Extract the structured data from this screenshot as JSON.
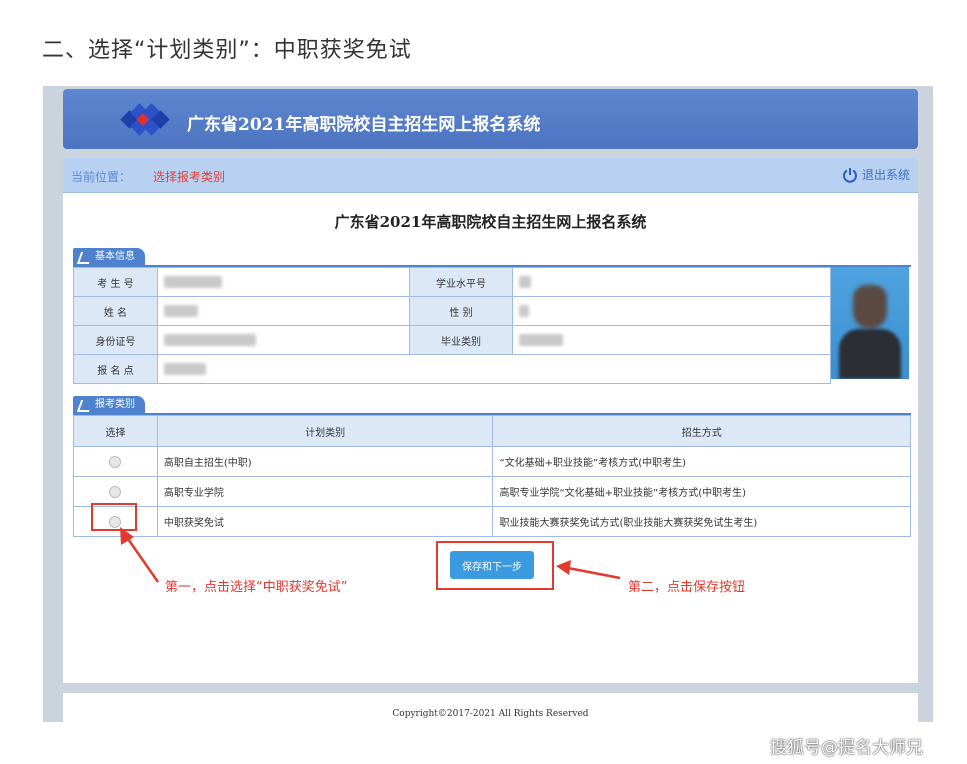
{
  "step_heading": "二、选择“计划类别”：中职获奖免试",
  "header": {
    "title": "广东省2021年高职院校自主招生网上报名系统"
  },
  "location_bar": {
    "label": "当前位置：",
    "value": "选择报考类别",
    "logout_label": "退出系统"
  },
  "form_title": "广东省2021年高职院校自主招生网上报名系统",
  "basic_info": {
    "tab_label": "基本信息",
    "rows": [
      {
        "label1": "考 生 号",
        "label2": "学业水平号"
      },
      {
        "label1": "姓     名",
        "label2": "性     别"
      },
      {
        "label1": "身份证号",
        "label2": "毕业类别"
      },
      {
        "label1": "报 名 点"
      }
    ]
  },
  "category": {
    "tab_label": "报考类别",
    "headers": [
      "选择",
      "计划类别",
      "招生方式"
    ],
    "rows": [
      {
        "plan": "高职自主招生(中职)",
        "method": "“文化基础+职业技能”考核方式(中职考生)"
      },
      {
        "plan": "高职专业学院",
        "method": "高职专业学院“文化基础+职业技能”考核方式(中职考生)"
      },
      {
        "plan": "中职获奖免试",
        "method": "职业技能大赛获奖免试方式(职业技能大赛获奖免试生考生)"
      }
    ]
  },
  "save_button": "保存和下一步",
  "annotations": {
    "note1": "第一，点击选择“中职获奖免试”",
    "note2": "第二，点击保存按钮",
    "color": "#e33a2e"
  },
  "footer": {
    "copyright": "Copyright©2017-2021  All Rights Reserved"
  },
  "watermark": "搜狐号@提名大师兄"
}
